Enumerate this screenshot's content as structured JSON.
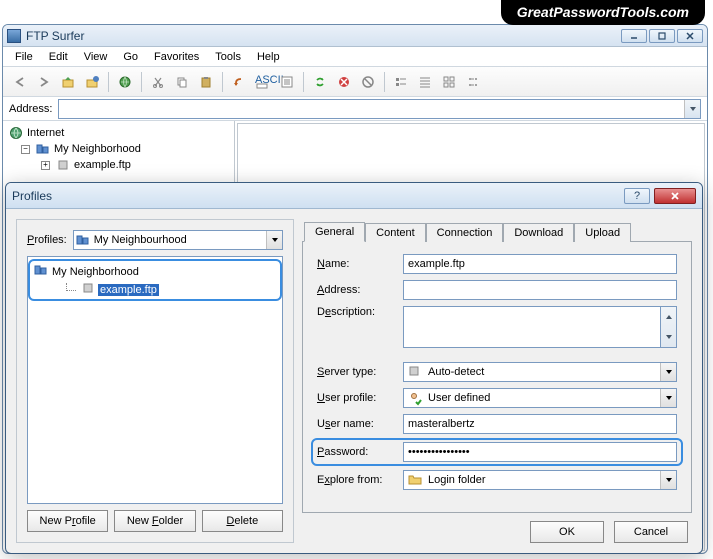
{
  "watermark": "GreatPasswordTools.com",
  "main_window": {
    "title": "FTP Surfer",
    "menu": [
      "File",
      "Edit",
      "View",
      "Go",
      "Favorites",
      "Tools",
      "Help"
    ],
    "address_label": "Address:",
    "address_value": "",
    "tree": {
      "internet": "Internet",
      "neighborhood": "My Neighborhood",
      "example": "example.ftp"
    }
  },
  "dialog": {
    "title": "Profiles",
    "profiles_label": "Profiles:",
    "profiles_combo": "My Neighbourhood",
    "tree": {
      "root": "My Neighborhood",
      "item": "example.ftp"
    },
    "buttons": {
      "new_profile": "New Profile",
      "new_folder": "New Folder",
      "delete": "Delete"
    },
    "tabs": [
      "General",
      "Content",
      "Connection",
      "Download",
      "Upload"
    ],
    "fields": {
      "name_label": "Name:",
      "name_value": "example.ftp",
      "address_label": "Address:",
      "address_value": "",
      "description_label": "Description:",
      "description_value": "",
      "server_type_label": "Server type:",
      "server_type_value": "Auto-detect",
      "user_profile_label": "User profile:",
      "user_profile_value": "User defined",
      "user_name_label": "User name:",
      "user_name_value": "masteralbertz",
      "password_label": "Password:",
      "password_value": "xxxxxxxxxxxxxxxx",
      "explore_label": "Explore from:",
      "explore_value": "Login folder"
    },
    "footer": {
      "ok": "OK",
      "cancel": "Cancel"
    }
  },
  "colors": {
    "highlight": "#3a8de0",
    "titlebar_text": "#1a3a5a"
  }
}
